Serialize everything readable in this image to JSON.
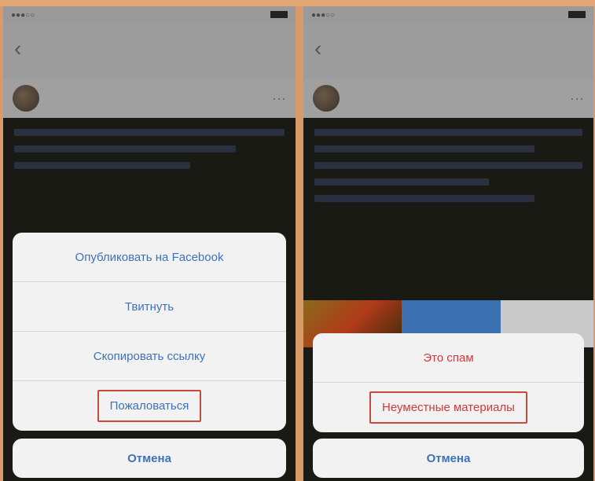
{
  "left": {
    "sheet_items": [
      {
        "label": "Опубликовать на Facebook"
      },
      {
        "label": "Твитнуть"
      },
      {
        "label": "Скопировать ссылку"
      },
      {
        "label": "Пожаловаться"
      }
    ],
    "cancel_label": "Отмена"
  },
  "right": {
    "sheet_items": [
      {
        "label": "Это спам"
      },
      {
        "label": "Неуместные материалы"
      }
    ],
    "cancel_label": "Отмена"
  },
  "colors": {
    "frame": "#d99a6a",
    "action_blue": "#3e72b8",
    "destructive_red": "#d03a3a",
    "highlight_box": "#c84a3a"
  },
  "icons": [
    "back-chevron-icon",
    "more-icon",
    "battery-icon"
  ]
}
